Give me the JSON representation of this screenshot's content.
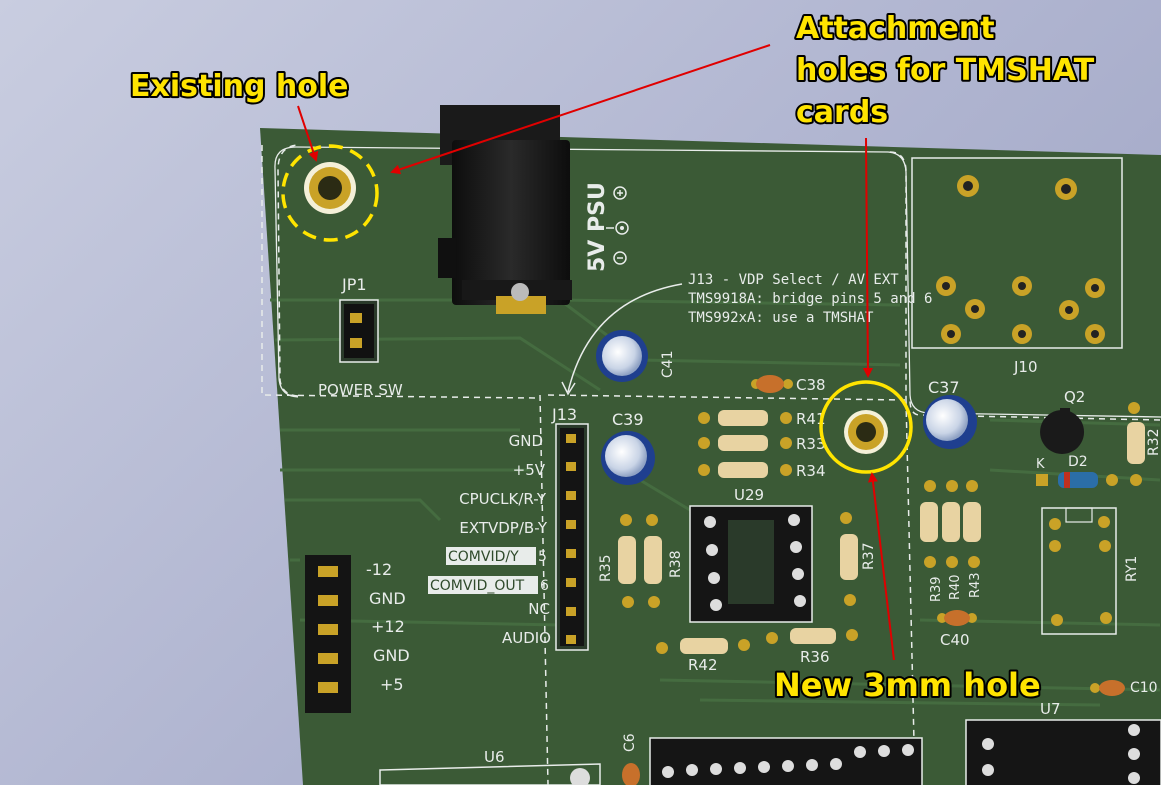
{
  "annotations": {
    "existing_hole": "Existing hole",
    "attachment_line1": "Attachment",
    "attachment_line2": "holes for TMSHAT",
    "attachment_line3": "cards",
    "new_hole": "New 3mm hole"
  },
  "board": {
    "psu_label": "5V PSU",
    "jp1": "JP1",
    "power_sw": "POWER SW",
    "j13_note_line1": "J13 - VDP Select / AV EXT",
    "j13_note_line2": "TMS9918A: bridge pins 5 and 6",
    "j13_note_line3": "TMS992xA: use a TMSHAT",
    "j13": "J13",
    "j13_pins": [
      "GND",
      "+5V",
      "CPUCLK/R-Y",
      "EXTVDP/B-Y",
      "COMVID/Y",
      "COMVID_OUT",
      "NC",
      "AUDIO"
    ],
    "j13_pin_numbers": [
      "5",
      "6"
    ],
    "power_pins": [
      "-12",
      "GND",
      "+12",
      "GND",
      "+5"
    ],
    "refs": {
      "c41": "C41",
      "c39": "C39",
      "c38": "C38",
      "c37": "C37",
      "c40": "C40",
      "c10": "C10",
      "c6": "C6",
      "r41": "R41",
      "r33": "R33",
      "r34": "R34",
      "r35": "R35",
      "r38": "R38",
      "r37": "R37",
      "r42": "R42",
      "r36": "R36",
      "r39": "R39",
      "r40": "R40",
      "r43": "R43",
      "r32": "R32",
      "u29": "U29",
      "u6": "U6",
      "u7": "U7",
      "j10": "J10",
      "q2": "Q2",
      "d2": "D2",
      "k": "K",
      "ry1": "RY1"
    }
  },
  "colors": {
    "pcb": "#3b5a36",
    "callout_text": "#ffe400",
    "arrow": "#e00000",
    "highlight_circle": "#ffe400",
    "pad_gold": "#c9a227"
  }
}
